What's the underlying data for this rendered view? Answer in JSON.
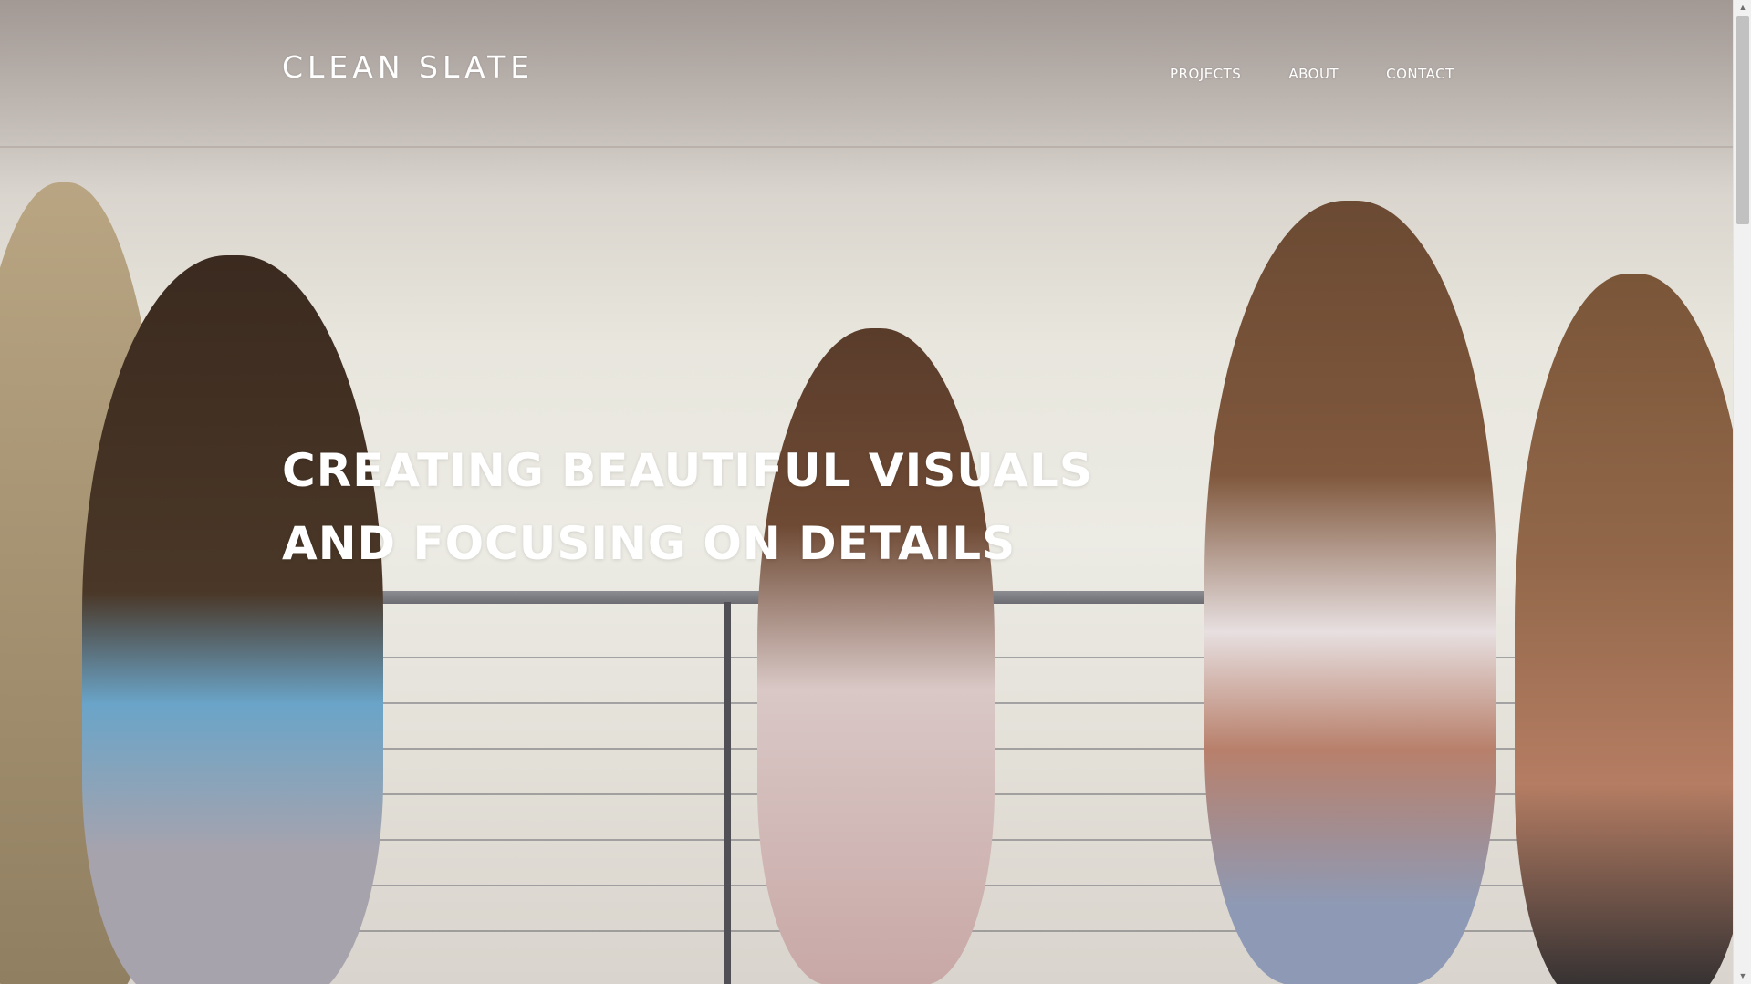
{
  "header": {
    "logo": "CLEAN SLATE",
    "nav": [
      "PROJECTS",
      "ABOUT",
      "CONTACT"
    ]
  },
  "hero": {
    "headline_line1": "CREATING BEAUTIFUL VISUALS",
    "headline_line2": "AND FOCUSING ON DETAILS",
    "background_description_icon": "hero-video-background"
  },
  "scrollbar": {
    "up_arrow": "▲",
    "down_arrow": "▼"
  },
  "colors": {
    "text": "#ffffff",
    "scrollbar_track": "#f1f1f1",
    "scrollbar_thumb": "#c1c1c1"
  }
}
